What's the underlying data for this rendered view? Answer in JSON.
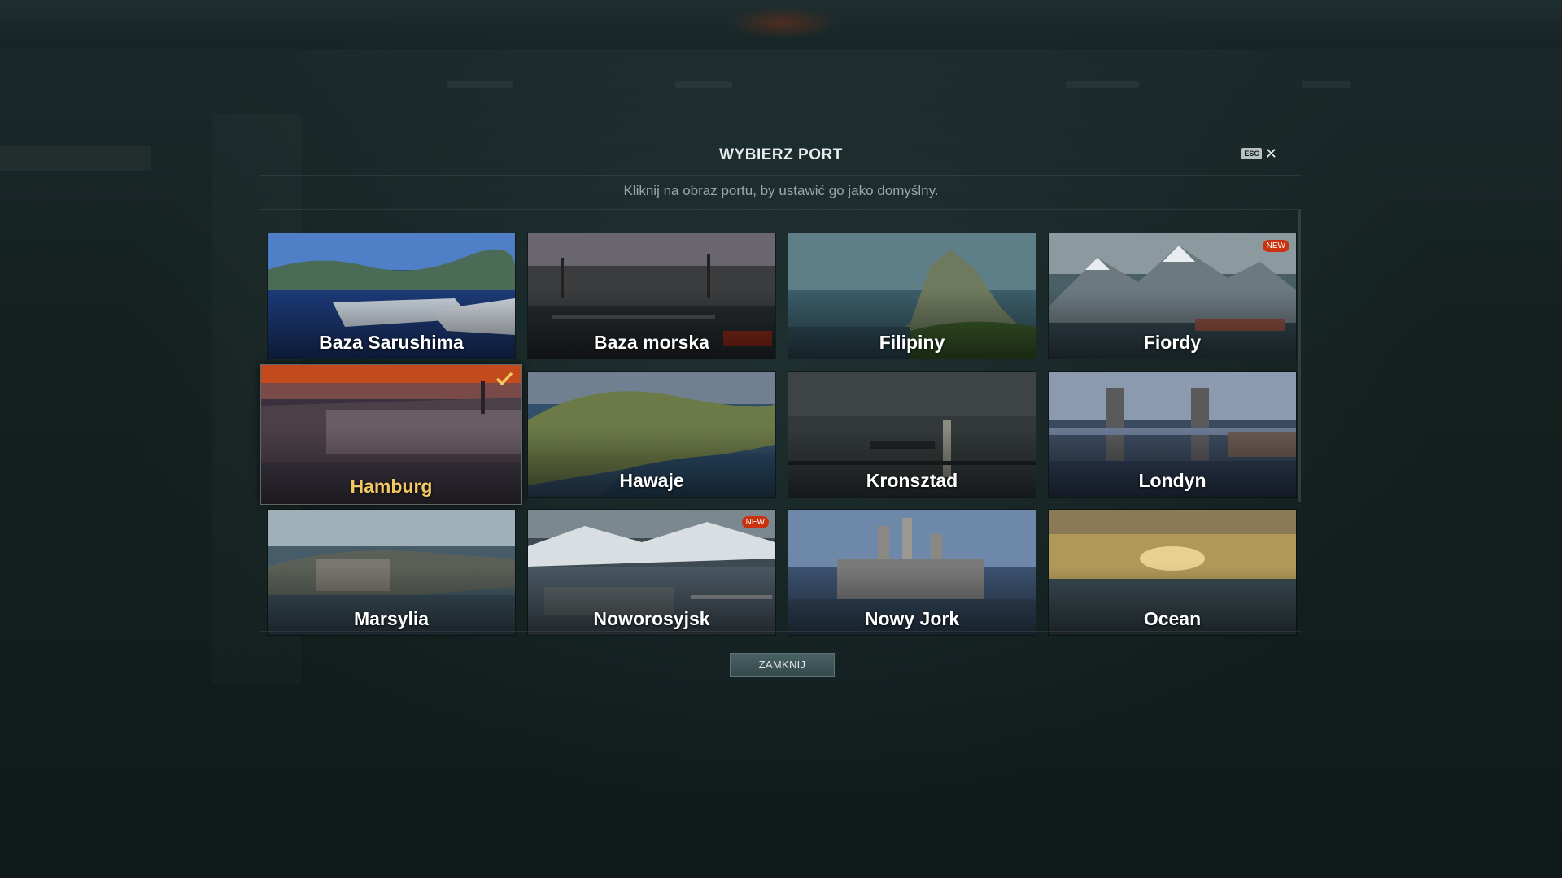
{
  "dialog": {
    "title": "WYBIERZ PORT",
    "esc_label": "ESC",
    "close_symbol": "✕",
    "subtitle": "Kliknij na obraz portu, by ustawić go jako domyślny.",
    "close_button_label": "ZAMKNIJ"
  },
  "ports": [
    {
      "name": "Baza Sarushima",
      "new": false,
      "selected": false,
      "scene": "harbor-day"
    },
    {
      "name": "Baza morska",
      "new": false,
      "selected": false,
      "scene": "naval-dusk"
    },
    {
      "name": "Filipiny",
      "new": false,
      "selected": false,
      "scene": "island-rock"
    },
    {
      "name": "Fiordy",
      "new": true,
      "badge": "NEW",
      "selected": false,
      "scene": "fjord-mountains"
    },
    {
      "name": "Hamburg",
      "new": false,
      "selected": true,
      "scene": "sunset-city"
    },
    {
      "name": "Hawaje",
      "new": false,
      "selected": false,
      "scene": "green-hills"
    },
    {
      "name": "Kronsztad",
      "new": false,
      "selected": false,
      "scene": "grey-sea"
    },
    {
      "name": "Londyn",
      "new": false,
      "selected": false,
      "scene": "bridge-city"
    },
    {
      "name": "Marsylia",
      "new": false,
      "selected": false,
      "scene": "coast-city"
    },
    {
      "name": "Noworosyjsk",
      "new": true,
      "badge": "NEW",
      "selected": false,
      "scene": "snow-port"
    },
    {
      "name": "Nowy Jork",
      "new": false,
      "selected": false,
      "scene": "skyline"
    },
    {
      "name": "Ocean",
      "new": false,
      "selected": false,
      "scene": "open-sea"
    }
  ],
  "colors": {
    "selected_label": "#f2c764",
    "new_badge": "#c8320f",
    "check": "#f2c764"
  }
}
